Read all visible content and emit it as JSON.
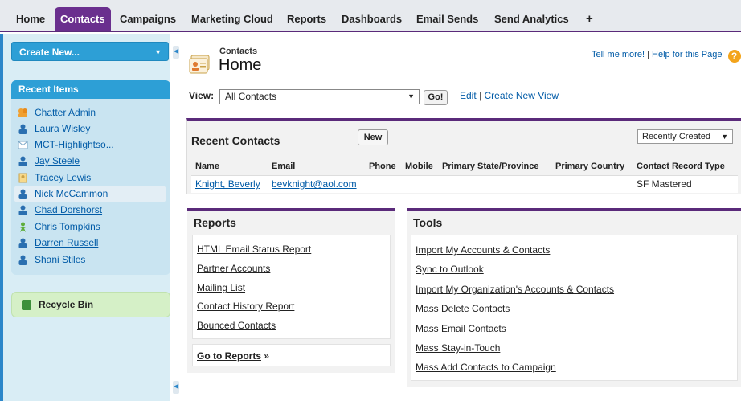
{
  "tabs": [
    {
      "label": "Home"
    },
    {
      "label": "Contacts",
      "active": true
    },
    {
      "label": "Campaigns"
    },
    {
      "label": "Marketing Cloud"
    },
    {
      "label": "Reports"
    },
    {
      "label": "Dashboards"
    },
    {
      "label": "Email Sends"
    },
    {
      "label": "Send Analytics"
    },
    {
      "label": "+"
    }
  ],
  "sidebar": {
    "create_new": "Create New...",
    "recent_items_title": "Recent Items",
    "recent_items": [
      {
        "label": "Chatter Admin",
        "icon": "group-icon"
      },
      {
        "label": "Laura Wisley",
        "icon": "contact-icon"
      },
      {
        "label": "MCT-Highlightso...",
        "icon": "email-icon"
      },
      {
        "label": "Jay Steele",
        "icon": "contact-icon"
      },
      {
        "label": "Tracey Lewis",
        "icon": "lead-icon"
      },
      {
        "label": "Nick McCammon",
        "icon": "contact-icon",
        "selected": true
      },
      {
        "label": "Chad Dorshorst",
        "icon": "contact-icon"
      },
      {
        "label": "Chris Tompkins",
        "icon": "user-icon"
      },
      {
        "label": "Darren Russell",
        "icon": "contact-icon"
      },
      {
        "label": "Shani Stiles",
        "icon": "contact-icon"
      }
    ],
    "recycle_bin": "Recycle Bin"
  },
  "header": {
    "object_label": "Contacts",
    "title": "Home",
    "tell_me_more": "Tell me more!",
    "separator": "|",
    "help": "Help for this Page",
    "help_icon": "?"
  },
  "view": {
    "label": "View:",
    "selected": "All Contacts",
    "go": "Go!",
    "edit": "Edit",
    "separator": "|",
    "create_new_view": "Create New View"
  },
  "recent_contacts": {
    "title": "Recent Contacts",
    "new_button": "New",
    "sort_selected": "Recently Created",
    "columns": [
      "Name",
      "Email",
      "Phone",
      "Mobile",
      "Primary State/Province",
      "Primary Country",
      "Contact Record Type"
    ],
    "rows": [
      {
        "name": "Knight, Beverly",
        "email": "bevknight@aol.com",
        "phone": "",
        "mobile": "",
        "state": "",
        "country": "",
        "record_type": "SF Mastered"
      }
    ]
  },
  "reports": {
    "title": "Reports",
    "links": [
      "HTML Email Status Report",
      "Partner Accounts",
      "Mailing List",
      "Contact History Report",
      "Bounced Contacts"
    ],
    "go_to_reports": "Go to Reports",
    "go_suffix": "»"
  },
  "tools": {
    "title": "Tools",
    "links": [
      "Import My Accounts & Contacts",
      "Sync to Outlook",
      "Import My Organization's Accounts & Contacts",
      "Mass Delete Contacts",
      "Mass Email Contacts",
      "Mass Stay-in-Touch",
      "Mass Add Contacts to Campaign"
    ]
  },
  "colors": {
    "accent_purple": "#6a2f8e",
    "sidebar_blue": "#2d9fd6",
    "link_blue": "#015ba7",
    "recycle_green": "#d5f0c7"
  }
}
